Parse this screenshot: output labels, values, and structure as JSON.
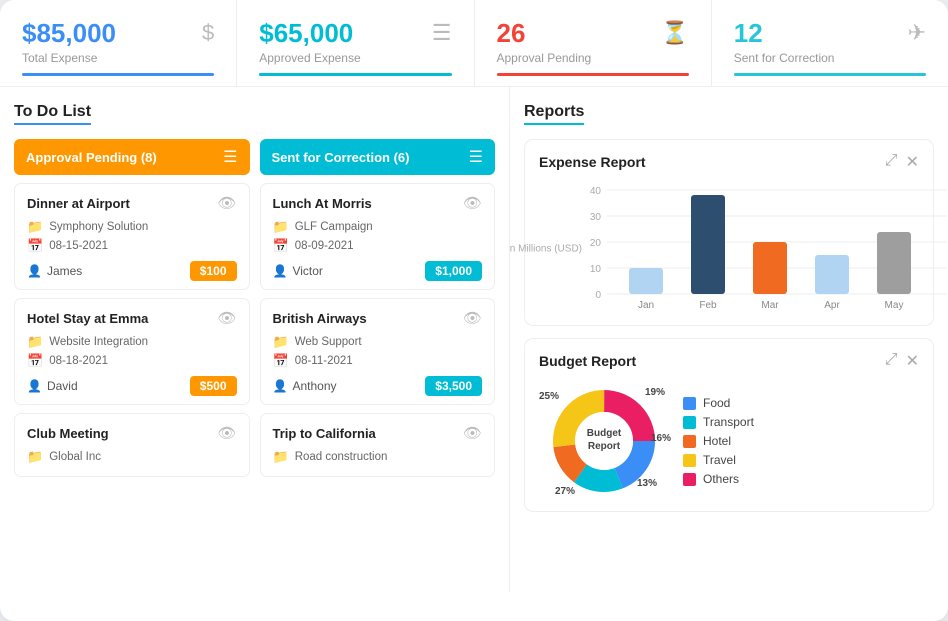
{
  "stats": [
    {
      "id": "total-expense",
      "value": "$85,000",
      "label": "Total Expense",
      "color": "blue",
      "icon": "$"
    },
    {
      "id": "approved-expense",
      "value": "$65,000",
      "label": "Approved Expense",
      "color": "teal",
      "icon": "☰"
    },
    {
      "id": "approval-pending",
      "value": "26",
      "label": "Approval Pending",
      "color": "red",
      "icon": "⏳"
    },
    {
      "id": "sent-for-correction",
      "value": "12",
      "label": "Sent for Correction",
      "color": "cyan",
      "icon": "✈"
    }
  ],
  "todoList": {
    "title": "To Do List",
    "columns": [
      {
        "id": "approval-pending-col",
        "header": "Approval Pending (8)",
        "color": "orange",
        "cards": [
          {
            "title": "Dinner at Airport",
            "folder": "Symphony Solution",
            "date": "08-15-2021",
            "user": "James",
            "amount": "$100",
            "amountColor": "orange"
          },
          {
            "title": "Hotel Stay at Emma",
            "folder": "Website Integration",
            "date": "08-18-2021",
            "user": "David",
            "amount": "$500",
            "amountColor": "orange"
          },
          {
            "title": "Club Meeting",
            "folder": "Global Inc",
            "date": "",
            "user": "",
            "amount": "",
            "amountColor": "orange"
          }
        ]
      },
      {
        "id": "sent-correction-col",
        "header": "Sent for Correction (6)",
        "color": "teal",
        "cards": [
          {
            "title": "Lunch At Morris",
            "folder": "GLF Campaign",
            "date": "08-09-2021",
            "user": "Victor",
            "amount": "$1,000",
            "amountColor": "teal"
          },
          {
            "title": "British Airways",
            "folder": "Web Support",
            "date": "08-11-2021",
            "user": "Anthony",
            "amount": "$3,500",
            "amountColor": "teal"
          },
          {
            "title": "Trip to California",
            "folder": "Road construction",
            "date": "",
            "user": "",
            "amount": "",
            "amountColor": "teal"
          }
        ]
      }
    ]
  },
  "reports": {
    "title": "Reports",
    "expenseReport": {
      "title": "Expense Report",
      "yAxisLabel": "In Millions (USD)",
      "bars": [
        {
          "label": "Jan",
          "value": 10,
          "color": "#b0d4f1"
        },
        {
          "label": "Feb",
          "value": 38,
          "color": "#2d4e6e"
        },
        {
          "label": "Mar",
          "value": 20,
          "color": "#f06a22"
        },
        {
          "label": "Apr",
          "value": 15,
          "color": "#b0d4f1"
        },
        {
          "label": "May",
          "value": 24,
          "color": "#9e9e9e"
        }
      ],
      "yMax": 40,
      "yTicks": [
        "40",
        "30",
        "20",
        "10",
        "0"
      ]
    },
    "budgetReport": {
      "title": "Budget Report",
      "segments": [
        {
          "label": "Food",
          "percent": 19,
          "color": "#3a8ef6",
          "startAngle": 0
        },
        {
          "label": "Transport",
          "percent": 16,
          "color": "#00bcd4",
          "startAngle": 68.4
        },
        {
          "label": "Hotel",
          "percent": 13,
          "color": "#f06a22",
          "startAngle": 126
        },
        {
          "label": "Travel",
          "percent": 27,
          "color": "#f5c518",
          "startAngle": 172.8
        },
        {
          "label": "Others",
          "percent": 25,
          "color": "#e91e63",
          "startAngle": 270
        }
      ],
      "centerLabel": "Budget\nReport"
    }
  }
}
